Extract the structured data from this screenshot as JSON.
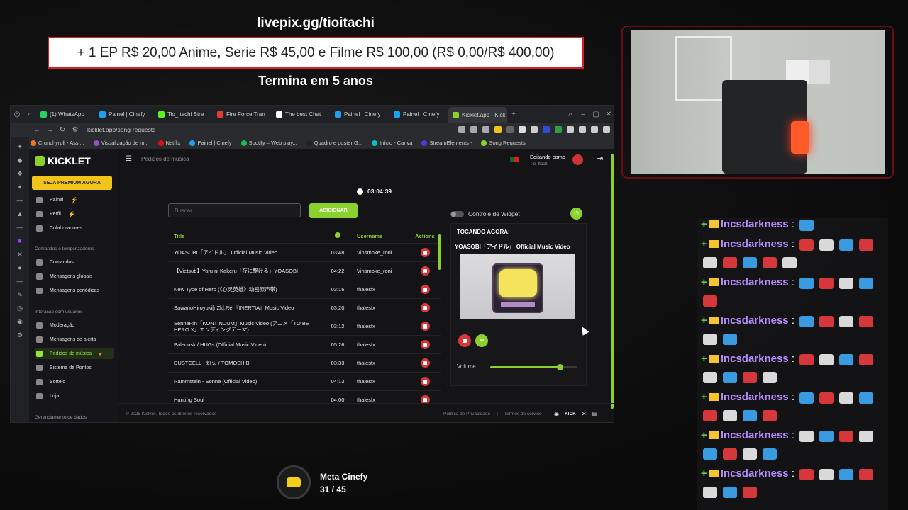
{
  "overlay": {
    "donate_url": "livepix.gg/tioitachi",
    "goal_text": "+ 1 EP R$ 20,00 Anime, Serie R$ 45,00 e Filme R$ 100,00 (R$ 0,00/R$ 400,00)",
    "goal_end": "Termina em 5 anos"
  },
  "browser": {
    "tabs": [
      {
        "label": "(1) WhatsApp",
        "color": "#25d366"
      },
      {
        "label": "Painel | Cinefy",
        "color": "#1da1f2"
      },
      {
        "label": "Tio_Itachi Stre",
        "color": "#53fc18"
      },
      {
        "label": "Fire Force Tran",
        "color": "#e03c31"
      },
      {
        "label": "The best Chat",
        "color": "#ffffff"
      },
      {
        "label": "Painel | Cinefy",
        "color": "#1da1f2"
      },
      {
        "label": "Painel | Cinefy",
        "color": "#1da1f2"
      },
      {
        "label": "Kicklet.app - Kick Ch",
        "color": "#8bd12d"
      }
    ],
    "new_tab": "+",
    "url": "kicklet.app/song-requests",
    "bookmarks": [
      {
        "label": "Crunchyroll - Assi...",
        "color": "#f47521"
      },
      {
        "label": "Visualização de m...",
        "color": "#9b4dca"
      },
      {
        "label": "Netflix",
        "color": "#e50914"
      },
      {
        "label": "Painel | Cinefy",
        "color": "#1da1f2"
      },
      {
        "label": "Spotify – Web play...",
        "color": "#1db954"
      },
      {
        "label": "Quadro e poster G...",
        "color": "#222222"
      },
      {
        "label": "Início - Canva",
        "color": "#00c4cc"
      },
      {
        "label": "StreamElements -",
        "color": "#4b3bd6"
      },
      {
        "label": "Song Requests",
        "color": "#8bd12d"
      }
    ]
  },
  "app": {
    "logo": "KICKLET",
    "premium_button": "SEJA PREMIUM AGORA",
    "sidebar": {
      "top_items": [
        "Painel",
        "Perfil",
        "Colaboradores"
      ],
      "section1": "Comandos e temporizadores",
      "section1_items": [
        "Comandos",
        "Mensagens globais",
        "Mensagens periódicas"
      ],
      "section2": "Interação com usuários",
      "section2_items": [
        "Moderação",
        "Mensagens de alerta",
        "Pedidos de música",
        "Sistema de Pontos",
        "Sorteio",
        "Loja"
      ],
      "section3": "Gerenciamento de dados"
    },
    "breadcrumb": "Pedidos de música",
    "editing_label": "Editando como",
    "editing_user": "Tio_Itachi",
    "timer": "03:04:39",
    "search_placeholder": "Buscar",
    "add_button": "ADICIONAR",
    "widget_control_label": "Controle de Widget",
    "table": {
      "headers": {
        "title": "Title",
        "username": "Username",
        "actions": "Actions"
      },
      "rows": [
        {
          "title": "YOASOBI「アイドル」 Official Music Video",
          "duration": "03:48",
          "user": "Vinsmoke_roni"
        },
        {
          "title": "【Vietsub】Yoru ni Kakeru「夜に駆ける」YOASOBI",
          "duration": "04:22",
          "user": "Vinsmoke_roni"
        },
        {
          "title": "New Type of Hero (《心灵英雄》动画原声带)",
          "duration": "03:16",
          "user": "thalesfx"
        },
        {
          "title": "SawanoHiroyuki[nZk]:Rei『INERTIA』Music Video",
          "duration": "03:20",
          "user": "thalesfx"
        },
        {
          "title": "SennaRin「KONTINUUM」Music Video (アニメ「TO BE HERO X」エンディングテーマ)",
          "duration": "03:12",
          "user": "thalesfx"
        },
        {
          "title": "Paledusk / HUGs (Official Music Video)",
          "duration": "05:26",
          "user": "thalesfx"
        },
        {
          "title": "DUSTCELL - 灯火 / TOMOSHIBI",
          "duration": "03:33",
          "user": "thalesfx"
        },
        {
          "title": "Rammstein - Sonne (Official Video)",
          "duration": "04:13",
          "user": "thalesfx"
        },
        {
          "title": "Hunting Soul",
          "duration": "04:00",
          "user": "thalesfx"
        }
      ]
    },
    "now_playing": {
      "label": "TOCANDO AGORA:",
      "song": "YOASOBI「アイドル」 Official Music Video",
      "volume_label": "Volume",
      "volume_level": 0.8
    },
    "footer": {
      "copyright": "© 2025 Kicklet. Todos os direitos reservados",
      "privacy": "Política de Privacidade",
      "separator": "|",
      "terms": "Termos de serviço",
      "kick": "KICK"
    }
  },
  "chat": {
    "username": "Incsdarkness",
    "separator": ":",
    "messages": [
      {
        "emotes": [
          "e3"
        ]
      },
      {
        "emotes": [
          "e1",
          "e2",
          "e3",
          "e1",
          "e2",
          "e1",
          "e3",
          "e1",
          "e2"
        ]
      },
      {
        "emotes": [
          "e3",
          "e1",
          "e2",
          "e3",
          "e1"
        ]
      },
      {
        "emotes": [
          "e3",
          "e1",
          "e2",
          "e1",
          "e2",
          "e3"
        ]
      },
      {
        "emotes": [
          "e1",
          "e2",
          "e3",
          "e1",
          "e2",
          "e3",
          "e1",
          "e2"
        ]
      },
      {
        "emotes": [
          "e3",
          "e1",
          "e2",
          "e3",
          "e1",
          "e2",
          "e3",
          "e1"
        ]
      },
      {
        "emotes": [
          "e2",
          "e3",
          "e1",
          "e2",
          "e3",
          "e1",
          "e2",
          "e3"
        ]
      },
      {
        "emotes": [
          "e1",
          "e2",
          "e3",
          "e1",
          "e2",
          "e3",
          "e1"
        ]
      }
    ]
  },
  "meta": {
    "name": "Meta Cinefy",
    "count": "31 / 45"
  }
}
